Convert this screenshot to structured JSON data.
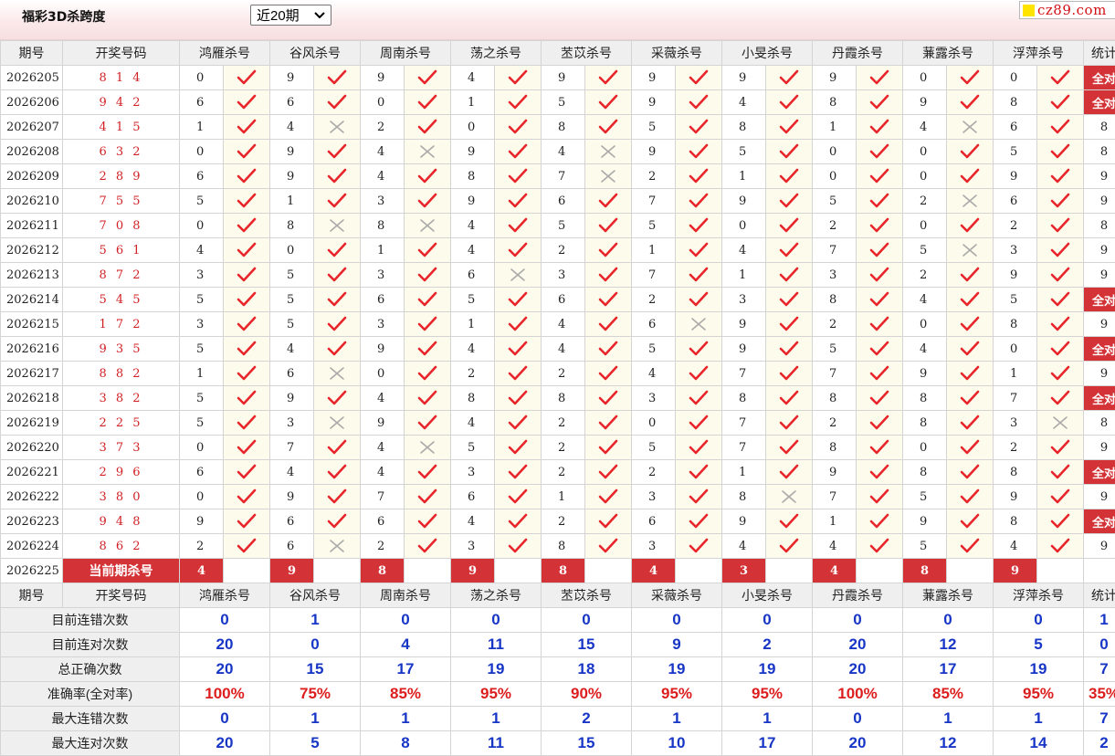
{
  "header": {
    "title": "福彩3D杀跨度",
    "select_value": "近20期",
    "logo_text": "cz89.com"
  },
  "columns": {
    "period": "期号",
    "draw": "开奖号码",
    "experts": [
      "鸿雁杀号",
      "谷风杀号",
      "周南杀号",
      "荡之杀号",
      "苤苡杀号",
      "采薇杀号",
      "小旻杀号",
      "丹霞杀号",
      "蒹露杀号",
      "浮萍杀号"
    ],
    "stat": "统计"
  },
  "rows": [
    {
      "p": "2026205",
      "d": "8 1 4",
      "k": [
        [
          0,
          1
        ],
        [
          9,
          1
        ],
        [
          9,
          1
        ],
        [
          4,
          1
        ],
        [
          9,
          1
        ],
        [
          9,
          1
        ],
        [
          9,
          1
        ],
        [
          9,
          1
        ],
        [
          0,
          1
        ],
        [
          0,
          1
        ]
      ],
      "s": "全对"
    },
    {
      "p": "2026206",
      "d": "9 4 2",
      "k": [
        [
          6,
          1
        ],
        [
          6,
          1
        ],
        [
          0,
          1
        ],
        [
          1,
          1
        ],
        [
          5,
          1
        ],
        [
          9,
          1
        ],
        [
          4,
          1
        ],
        [
          8,
          1
        ],
        [
          9,
          1
        ],
        [
          8,
          1
        ]
      ],
      "s": "全对"
    },
    {
      "p": "2026207",
      "d": "4 1 5",
      "k": [
        [
          1,
          1
        ],
        [
          4,
          0
        ],
        [
          2,
          1
        ],
        [
          0,
          1
        ],
        [
          8,
          1
        ],
        [
          5,
          1
        ],
        [
          8,
          1
        ],
        [
          1,
          1
        ],
        [
          4,
          0
        ],
        [
          6,
          1
        ]
      ],
      "s": "8"
    },
    {
      "p": "2026208",
      "d": "6 3 2",
      "k": [
        [
          0,
          1
        ],
        [
          9,
          1
        ],
        [
          4,
          0
        ],
        [
          9,
          1
        ],
        [
          4,
          0
        ],
        [
          9,
          1
        ],
        [
          5,
          1
        ],
        [
          0,
          1
        ],
        [
          0,
          1
        ],
        [
          5,
          1
        ]
      ],
      "s": "8"
    },
    {
      "p": "2026209",
      "d": "2 8 9",
      "k": [
        [
          6,
          1
        ],
        [
          9,
          1
        ],
        [
          4,
          1
        ],
        [
          8,
          1
        ],
        [
          7,
          0
        ],
        [
          2,
          1
        ],
        [
          1,
          1
        ],
        [
          0,
          1
        ],
        [
          0,
          1
        ],
        [
          9,
          1
        ]
      ],
      "s": "9"
    },
    {
      "p": "2026210",
      "d": "7 5 5",
      "k": [
        [
          5,
          1
        ],
        [
          1,
          1
        ],
        [
          3,
          1
        ],
        [
          9,
          1
        ],
        [
          6,
          1
        ],
        [
          7,
          1
        ],
        [
          9,
          1
        ],
        [
          5,
          1
        ],
        [
          2,
          0
        ],
        [
          6,
          1
        ]
      ],
      "s": "9"
    },
    {
      "p": "2026211",
      "d": "7 0 8",
      "k": [
        [
          0,
          1
        ],
        [
          8,
          0
        ],
        [
          8,
          0
        ],
        [
          4,
          1
        ],
        [
          5,
          1
        ],
        [
          5,
          1
        ],
        [
          0,
          1
        ],
        [
          2,
          1
        ],
        [
          0,
          1
        ],
        [
          2,
          1
        ]
      ],
      "s": "8"
    },
    {
      "p": "2026212",
      "d": "5 6 1",
      "k": [
        [
          4,
          1
        ],
        [
          0,
          1
        ],
        [
          1,
          1
        ],
        [
          4,
          1
        ],
        [
          2,
          1
        ],
        [
          1,
          1
        ],
        [
          4,
          1
        ],
        [
          7,
          1
        ],
        [
          5,
          0
        ],
        [
          3,
          1
        ]
      ],
      "s": "9"
    },
    {
      "p": "2026213",
      "d": "8 7 2",
      "k": [
        [
          3,
          1
        ],
        [
          5,
          1
        ],
        [
          3,
          1
        ],
        [
          6,
          0
        ],
        [
          3,
          1
        ],
        [
          7,
          1
        ],
        [
          1,
          1
        ],
        [
          3,
          1
        ],
        [
          2,
          1
        ],
        [
          9,
          1
        ]
      ],
      "s": "9"
    },
    {
      "p": "2026214",
      "d": "5 4 5",
      "k": [
        [
          5,
          1
        ],
        [
          5,
          1
        ],
        [
          6,
          1
        ],
        [
          5,
          1
        ],
        [
          6,
          1
        ],
        [
          2,
          1
        ],
        [
          3,
          1
        ],
        [
          8,
          1
        ],
        [
          4,
          1
        ],
        [
          5,
          1
        ]
      ],
      "s": "全对"
    },
    {
      "p": "2026215",
      "d": "1 7 2",
      "k": [
        [
          3,
          1
        ],
        [
          5,
          1
        ],
        [
          3,
          1
        ],
        [
          1,
          1
        ],
        [
          4,
          1
        ],
        [
          6,
          0
        ],
        [
          9,
          1
        ],
        [
          2,
          1
        ],
        [
          0,
          1
        ],
        [
          8,
          1
        ]
      ],
      "s": "9"
    },
    {
      "p": "2026216",
      "d": "9 3 5",
      "k": [
        [
          5,
          1
        ],
        [
          4,
          1
        ],
        [
          9,
          1
        ],
        [
          4,
          1
        ],
        [
          4,
          1
        ],
        [
          5,
          1
        ],
        [
          9,
          1
        ],
        [
          5,
          1
        ],
        [
          4,
          1
        ],
        [
          0,
          1
        ]
      ],
      "s": "全对"
    },
    {
      "p": "2026217",
      "d": "8 8 2",
      "k": [
        [
          1,
          1
        ],
        [
          6,
          0
        ],
        [
          0,
          1
        ],
        [
          2,
          1
        ],
        [
          2,
          1
        ],
        [
          4,
          1
        ],
        [
          7,
          1
        ],
        [
          7,
          1
        ],
        [
          9,
          1
        ],
        [
          1,
          1
        ]
      ],
      "s": "9"
    },
    {
      "p": "2026218",
      "d": "3 8 2",
      "k": [
        [
          5,
          1
        ],
        [
          9,
          1
        ],
        [
          4,
          1
        ],
        [
          8,
          1
        ],
        [
          8,
          1
        ],
        [
          3,
          1
        ],
        [
          8,
          1
        ],
        [
          8,
          1
        ],
        [
          8,
          1
        ],
        [
          7,
          1
        ]
      ],
      "s": "全对"
    },
    {
      "p": "2026219",
      "d": "2 2 5",
      "k": [
        [
          5,
          1
        ],
        [
          3,
          0
        ],
        [
          9,
          1
        ],
        [
          4,
          1
        ],
        [
          2,
          1
        ],
        [
          0,
          1
        ],
        [
          7,
          1
        ],
        [
          2,
          1
        ],
        [
          8,
          1
        ],
        [
          3,
          0
        ]
      ],
      "s": "8"
    },
    {
      "p": "2026220",
      "d": "3 7 3",
      "k": [
        [
          0,
          1
        ],
        [
          7,
          1
        ],
        [
          4,
          0
        ],
        [
          5,
          1
        ],
        [
          2,
          1
        ],
        [
          5,
          1
        ],
        [
          7,
          1
        ],
        [
          8,
          1
        ],
        [
          0,
          1
        ],
        [
          2,
          1
        ]
      ],
      "s": "9"
    },
    {
      "p": "2026221",
      "d": "2 9 6",
      "k": [
        [
          6,
          1
        ],
        [
          4,
          1
        ],
        [
          4,
          1
        ],
        [
          3,
          1
        ],
        [
          2,
          1
        ],
        [
          2,
          1
        ],
        [
          1,
          1
        ],
        [
          9,
          1
        ],
        [
          8,
          1
        ],
        [
          8,
          1
        ]
      ],
      "s": "全对"
    },
    {
      "p": "2026222",
      "d": "3 8 0",
      "k": [
        [
          0,
          1
        ],
        [
          9,
          1
        ],
        [
          7,
          1
        ],
        [
          6,
          1
        ],
        [
          1,
          1
        ],
        [
          3,
          1
        ],
        [
          8,
          0
        ],
        [
          7,
          1
        ],
        [
          5,
          1
        ],
        [
          9,
          1
        ]
      ],
      "s": "9"
    },
    {
      "p": "2026223",
      "d": "9 4 8",
      "k": [
        [
          9,
          1
        ],
        [
          6,
          1
        ],
        [
          6,
          1
        ],
        [
          4,
          1
        ],
        [
          2,
          1
        ],
        [
          6,
          1
        ],
        [
          9,
          1
        ],
        [
          1,
          1
        ],
        [
          9,
          1
        ],
        [
          8,
          1
        ]
      ],
      "s": "全对"
    },
    {
      "p": "2026224",
      "d": "8 6 2",
      "k": [
        [
          2,
          1
        ],
        [
          6,
          0
        ],
        [
          2,
          1
        ],
        [
          3,
          1
        ],
        [
          8,
          1
        ],
        [
          3,
          1
        ],
        [
          4,
          1
        ],
        [
          4,
          1
        ],
        [
          5,
          1
        ],
        [
          4,
          1
        ]
      ],
      "s": "9"
    }
  ],
  "current": {
    "period": "2026225",
    "label": "当前期杀号",
    "kills": [
      "4",
      "9",
      "8",
      "9",
      "8",
      "4",
      "3",
      "4",
      "8",
      "9"
    ]
  },
  "summary": [
    {
      "label": "目前连错次数",
      "pct": false,
      "vals": [
        "0",
        "1",
        "0",
        "0",
        "0",
        "0",
        "0",
        "0",
        "0",
        "0",
        "1"
      ]
    },
    {
      "label": "目前连对次数",
      "pct": false,
      "vals": [
        "20",
        "0",
        "4",
        "11",
        "15",
        "9",
        "2",
        "20",
        "12",
        "5",
        "0"
      ]
    },
    {
      "label": "总正确次数",
      "pct": false,
      "vals": [
        "20",
        "15",
        "17",
        "19",
        "18",
        "19",
        "19",
        "20",
        "17",
        "19",
        "7"
      ]
    },
    {
      "label": "准确率(全对率)",
      "pct": true,
      "vals": [
        "100%",
        "75%",
        "85%",
        "95%",
        "90%",
        "95%",
        "95%",
        "100%",
        "85%",
        "95%",
        "35%"
      ]
    },
    {
      "label": "最大连错次数",
      "pct": false,
      "vals": [
        "0",
        "1",
        "1",
        "1",
        "2",
        "1",
        "1",
        "0",
        "1",
        "1",
        "7"
      ]
    },
    {
      "label": "最大连对次数",
      "pct": false,
      "vals": [
        "20",
        "5",
        "8",
        "11",
        "15",
        "10",
        "17",
        "20",
        "12",
        "14",
        "2"
      ]
    }
  ],
  "colors": {
    "accent_red": "#d33337",
    "check_red": "#e8252b",
    "cross_gray": "#aaaaaa",
    "stat_blue": "#1836c6"
  }
}
